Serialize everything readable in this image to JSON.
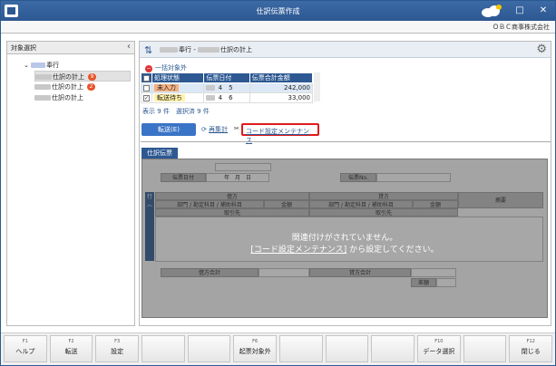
{
  "window": {
    "title": "仕訳伝票作成",
    "company": "ＯＢＣ商事株式会社"
  },
  "left": {
    "header": "対象選択",
    "root": "奉行",
    "items": [
      {
        "label": "仕訳の計上",
        "count": "9"
      },
      {
        "label": "仕訳の計上",
        "count": "2"
      },
      {
        "label": "仕訳の計上",
        "count": ""
      }
    ]
  },
  "main": {
    "heading_app": "奉行",
    "heading_sep": " - ",
    "heading_item": "仕訳の計上",
    "exclude_link": "一括対象外",
    "columns": [
      "処理状態",
      "伝票日付",
      "伝票合計金額"
    ],
    "rows": [
      {
        "checked": false,
        "status": "未入力",
        "month": "4",
        "day": "5",
        "amount": "242,000"
      },
      {
        "checked": true,
        "status": "転送待ち",
        "month": "4",
        "day": "6",
        "amount": "33,000"
      }
    ],
    "shown": "表示 9 件",
    "selected": "選択済 9 件",
    "transfer_btn": "転送(E)",
    "recalc": "再集計",
    "code_link": "コード設定メンテナンス",
    "tab": "仕訳伝票",
    "slip": {
      "date_label": "伝票日付",
      "date_value": "年　月　日",
      "no_label": "伝票No.",
      "row_label": "行",
      "debit": "借方",
      "credit": "貸方",
      "subject": "部門 / 勘定科目 / 補助科目",
      "amount": "金額",
      "partner": "取引先",
      "memo": "摘要",
      "debit_total": "借方合計",
      "credit_total": "貸方合計",
      "diff": "差額"
    },
    "overlay_line1": "関連付けがされていません。",
    "overlay_link": "[コード設定メンテナンス]",
    "overlay_line2": " から設定してください。"
  },
  "fkeys": [
    {
      "key": "F1",
      "label": "ヘルプ"
    },
    {
      "key": "F2",
      "label": "転送"
    },
    {
      "key": "F3",
      "label": "設定"
    },
    {
      "key": "",
      "label": ""
    },
    {
      "key": "",
      "label": ""
    },
    {
      "key": "F6",
      "label": "起票対象外"
    },
    {
      "key": "",
      "label": ""
    },
    {
      "key": "",
      "label": ""
    },
    {
      "key": "",
      "label": ""
    },
    {
      "key": "F10",
      "label": "データ選択"
    },
    {
      "key": "",
      "label": ""
    },
    {
      "key": "F12",
      "label": "閉じる"
    }
  ],
  "colors": {
    "brand": "#2d5892",
    "highlight": "#e01b1b",
    "badge": "#e8542a"
  }
}
